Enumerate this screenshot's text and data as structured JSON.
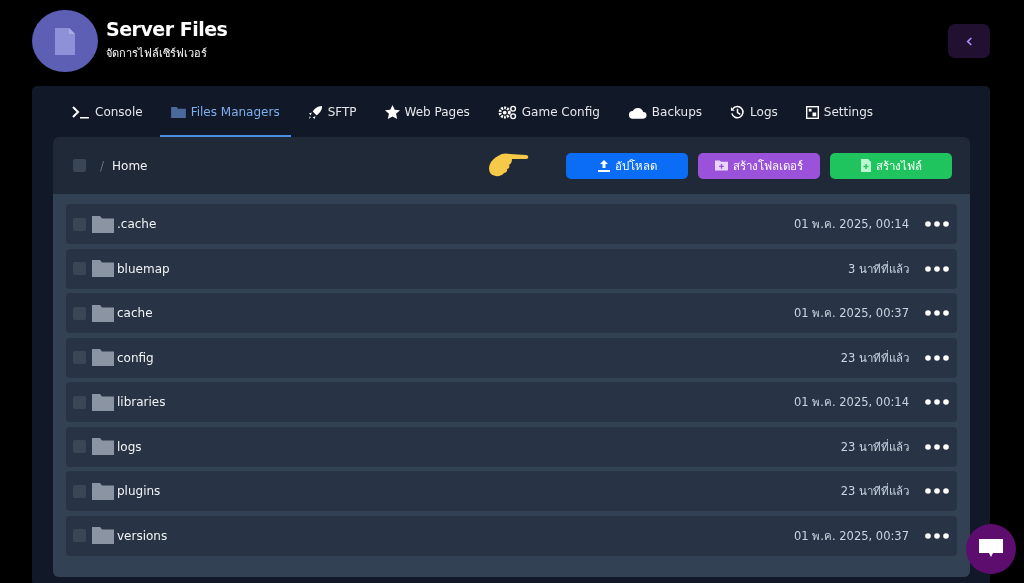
{
  "header": {
    "title": "Server Files",
    "subtitle": "จัดการไฟล์เซิร์ฟเวอร์"
  },
  "tabs": [
    {
      "label": "Console",
      "selected": false
    },
    {
      "label": "Files Managers",
      "selected": true
    },
    {
      "label": "SFTP",
      "selected": false
    },
    {
      "label": "Web Pages",
      "selected": false
    },
    {
      "label": "Game Config",
      "selected": false
    },
    {
      "label": "Backups",
      "selected": false
    },
    {
      "label": "Logs",
      "selected": false
    },
    {
      "label": "Settings",
      "selected": false
    }
  ],
  "toolbar": {
    "select_all_checked": false,
    "separator": "/",
    "breadcrumb": "Home",
    "buttons": [
      {
        "label": "อัปโหลด",
        "kind": "upload"
      },
      {
        "label": "สร้างโฟลเดอร์",
        "kind": "folder"
      },
      {
        "label": "สร้างไฟล์",
        "kind": "file"
      }
    ]
  },
  "files": [
    {
      "name": ".cache",
      "modified": "01 พ.ค. 2025, 00:14",
      "checked": false
    },
    {
      "name": "bluemap",
      "modified": "3 นาทีที่แล้ว",
      "checked": false
    },
    {
      "name": "cache",
      "modified": "01 พ.ค. 2025, 00:37",
      "checked": false
    },
    {
      "name": "config",
      "modified": "23 นาทีที่แล้ว",
      "checked": false
    },
    {
      "name": "libraries",
      "modified": "01 พ.ค. 2025, 00:14",
      "checked": false
    },
    {
      "name": "logs",
      "modified": "23 นาทีที่แล้ว",
      "checked": false
    },
    {
      "name": "plugins",
      "modified": "23 นาทีที่แล้ว",
      "checked": false
    },
    {
      "name": "versions",
      "modified": "01 พ.ค. 2025, 00:37",
      "checked": false
    }
  ]
}
